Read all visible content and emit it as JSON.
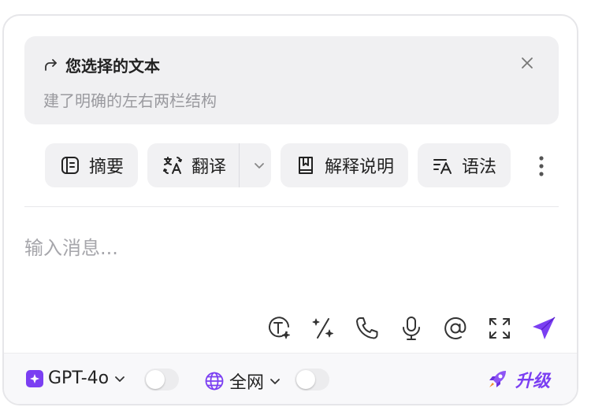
{
  "quote": {
    "title": "您选择的文本",
    "text": "建了明确的左右两栏结构",
    "icon": "share-arrow-icon",
    "close_icon": "close-icon"
  },
  "actions": [
    {
      "label": "摘要",
      "icon": "summary-icon"
    },
    {
      "label": "翻译",
      "icon": "translate-icon"
    },
    {
      "label": "解释说明",
      "icon": "bookmark-book-icon"
    },
    {
      "label": "语法",
      "icon": "grammar-icon"
    }
  ],
  "input": {
    "placeholder": "输入消息..."
  },
  "tools": [
    "text-ai-icon",
    "magic-wand-icon",
    "phone-icon",
    "microphone-icon",
    "at-icon",
    "fullscreen-icon",
    "send-icon"
  ],
  "footer": {
    "model": "GPT-4o",
    "web": "全网",
    "upgrade": "升级",
    "toggle_model_on": false,
    "toggle_web_on": false
  },
  "colors": {
    "accent": "#7b3ff2",
    "chip_bg": "#f1f1f3",
    "quote_bg": "#f0f0f2"
  }
}
